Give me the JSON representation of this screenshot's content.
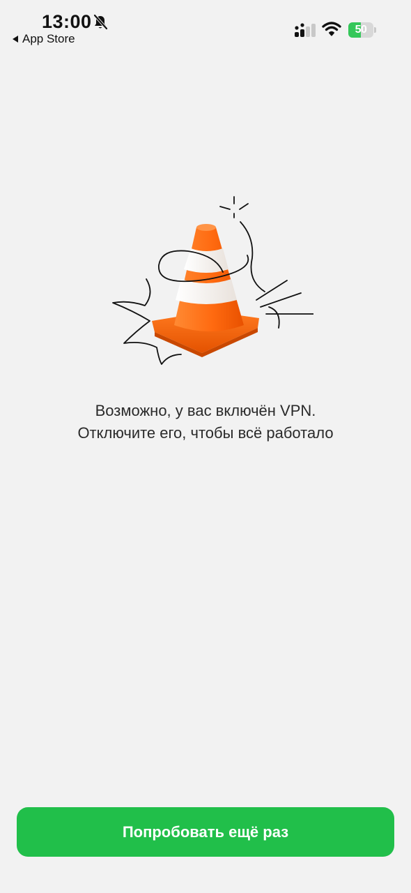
{
  "status_bar": {
    "time": "13:00",
    "back_label": "App Store",
    "battery_percent": 50,
    "battery_label": "50",
    "icons": [
      "bell-slash-icon",
      "cellular-signal-icon",
      "wifi-icon",
      "battery-icon"
    ]
  },
  "message": {
    "line1": "Возможно, у вас включён VPN.",
    "line2": "Отключите его, чтобы всё работало"
  },
  "button": {
    "label": "Попробовать ещё раз"
  },
  "colors": {
    "background": "#f2f2f2",
    "accent": "#21bf4a",
    "cone_orange": "#ff6a10",
    "battery_green": "#34c759"
  },
  "illustration": {
    "icon": "traffic-cone-icon"
  }
}
